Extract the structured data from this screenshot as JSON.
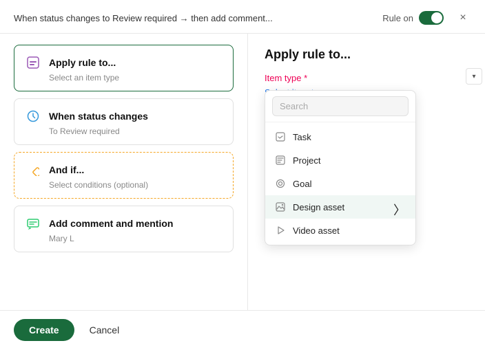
{
  "modal": {
    "rule_description": "When status changes to Review required → then add comment...",
    "rule_on_label": "Rule on",
    "close_label": "×"
  },
  "right_panel": {
    "title": "Apply rule to...",
    "item_type_label": "Item type",
    "required_mark": "*",
    "select_placeholder": "Select item type"
  },
  "steps": [
    {
      "id": "apply-rule",
      "title": "Apply rule to...",
      "subtitle": "Select an item type",
      "icon_type": "square-dotted",
      "active": true
    },
    {
      "id": "when-status",
      "title": "When status changes",
      "subtitle": "To Review required",
      "icon_type": "lightning",
      "active": false
    },
    {
      "id": "and-if",
      "title": "And if...",
      "subtitle": "Select conditions (optional)",
      "icon_type": "diamond",
      "active": false,
      "dashed": true
    },
    {
      "id": "add-comment",
      "title": "Add comment and mention",
      "subtitle": "Mary L",
      "icon_type": "comment",
      "active": false
    }
  ],
  "dropdown": {
    "search_placeholder": "Search",
    "items": [
      {
        "label": "Task",
        "icon": "task"
      },
      {
        "label": "Project",
        "icon": "project"
      },
      {
        "label": "Goal",
        "icon": "goal"
      },
      {
        "label": "Design asset",
        "icon": "design",
        "highlighted": true
      },
      {
        "label": "Video asset",
        "icon": "video"
      }
    ]
  },
  "footer": {
    "create_label": "Create",
    "cancel_label": "Cancel"
  }
}
